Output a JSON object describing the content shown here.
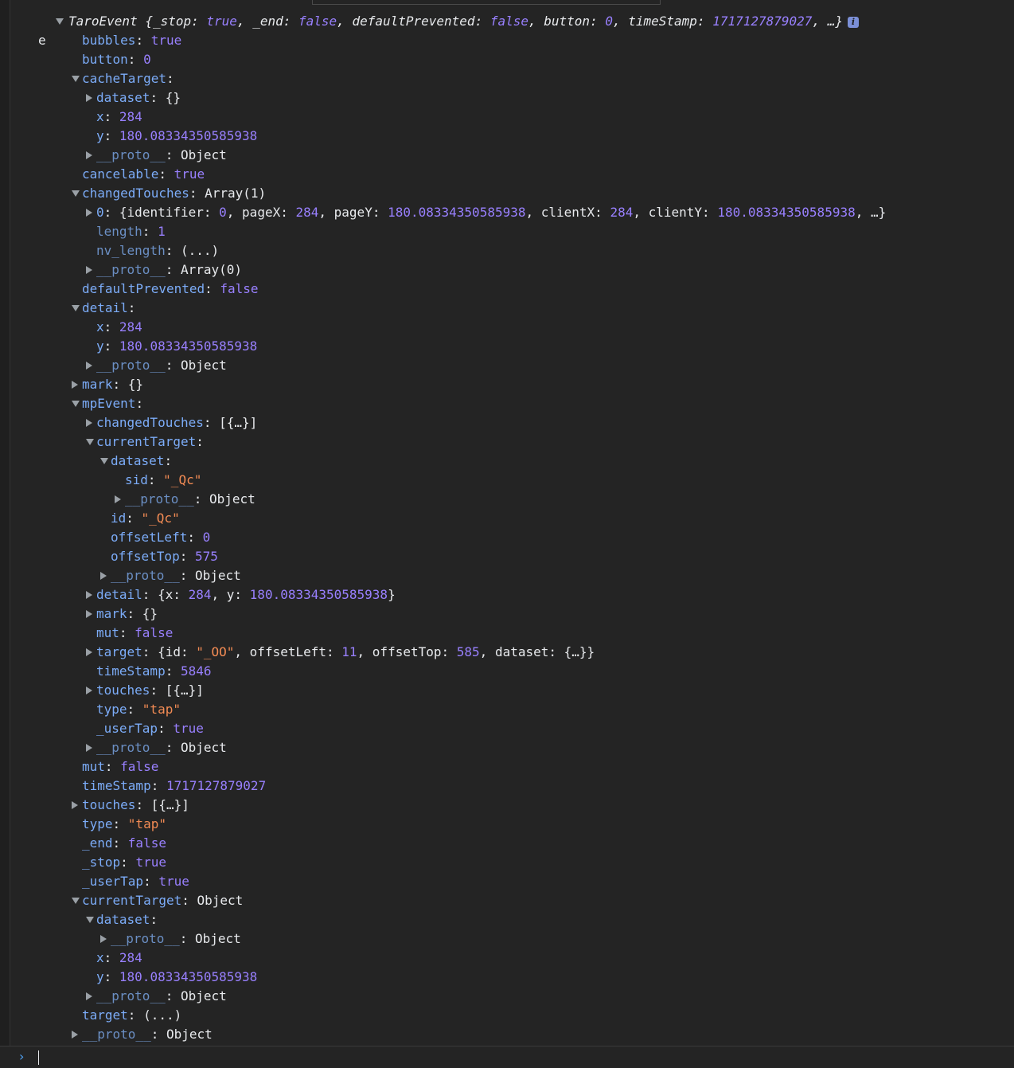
{
  "console": {
    "variable": "e",
    "summary": {
      "class_name": "TaroEvent",
      "open": "{",
      "props": [
        {
          "key": "_stop",
          "value": "true",
          "type": "b"
        },
        {
          "key": "_end",
          "value": "false",
          "type": "b"
        },
        {
          "key": "defaultPrevented",
          "value": "false",
          "type": "b"
        },
        {
          "key": "button",
          "value": "0",
          "type": "n"
        },
        {
          "key": "timeStamp",
          "value": "1717127879027",
          "type": "n"
        }
      ],
      "ellipsis": "…}",
      "info_badge": "i"
    },
    "rows": [
      {
        "indent": 1,
        "tri": "none",
        "key": "bubbles",
        "value": "true",
        "vtype": "b"
      },
      {
        "indent": 1,
        "tri": "none",
        "key": "button",
        "value": "0",
        "vtype": "n"
      },
      {
        "indent": 1,
        "tri": "open",
        "key": "cacheTarget",
        "value": "",
        "vtype": "p"
      },
      {
        "indent": 2,
        "tri": "closed",
        "key": "dataset",
        "value": "{}",
        "vtype": "p"
      },
      {
        "indent": 2,
        "tri": "none",
        "key": "x",
        "value": "284",
        "vtype": "n"
      },
      {
        "indent": 2,
        "tri": "none",
        "key": "y",
        "value": "180.08334350585938",
        "vtype": "n"
      },
      {
        "indent": 2,
        "tri": "closed",
        "key": "__proto__",
        "value": "Object",
        "vtype": "p",
        "dim": true
      },
      {
        "indent": 1,
        "tri": "none",
        "key": "cancelable",
        "value": "true",
        "vtype": "b"
      },
      {
        "indent": 1,
        "tri": "open",
        "key": "changedTouches",
        "value": "Array(1)",
        "vtype": "p"
      },
      {
        "indent": 2,
        "tri": "closed",
        "key": "0",
        "value": "",
        "vtype": "rich",
        "rich": "touch0"
      },
      {
        "indent": 2,
        "tri": "none",
        "key": "length",
        "value": "1",
        "vtype": "n",
        "dim": true
      },
      {
        "indent": 2,
        "tri": "none",
        "key": "nv_length",
        "value": "(...)",
        "vtype": "p",
        "dim": true
      },
      {
        "indent": 2,
        "tri": "closed",
        "key": "__proto__",
        "value": "Array(0)",
        "vtype": "p",
        "dim": true
      },
      {
        "indent": 1,
        "tri": "none",
        "key": "defaultPrevented",
        "value": "false",
        "vtype": "b"
      },
      {
        "indent": 1,
        "tri": "open",
        "key": "detail",
        "value": "",
        "vtype": "p"
      },
      {
        "indent": 2,
        "tri": "none",
        "key": "x",
        "value": "284",
        "vtype": "n"
      },
      {
        "indent": 2,
        "tri": "none",
        "key": "y",
        "value": "180.08334350585938",
        "vtype": "n"
      },
      {
        "indent": 2,
        "tri": "closed",
        "key": "__proto__",
        "value": "Object",
        "vtype": "p",
        "dim": true
      },
      {
        "indent": 1,
        "tri": "closed",
        "key": "mark",
        "value": "{}",
        "vtype": "p"
      },
      {
        "indent": 1,
        "tri": "open",
        "key": "mpEvent",
        "value": "",
        "vtype": "p"
      },
      {
        "indent": 2,
        "tri": "closed",
        "key": "changedTouches",
        "value": "[{…}]",
        "vtype": "p"
      },
      {
        "indent": 2,
        "tri": "open",
        "key": "currentTarget",
        "value": "",
        "vtype": "p"
      },
      {
        "indent": 3,
        "tri": "open",
        "key": "dataset",
        "value": "",
        "vtype": "p"
      },
      {
        "indent": 4,
        "tri": "none",
        "key": "sid",
        "value": "\"_Qc\"",
        "vtype": "s"
      },
      {
        "indent": 4,
        "tri": "closed",
        "key": "__proto__",
        "value": "Object",
        "vtype": "p",
        "dim": true
      },
      {
        "indent": 3,
        "tri": "none",
        "key": "id",
        "value": "\"_Qc\"",
        "vtype": "s"
      },
      {
        "indent": 3,
        "tri": "none",
        "key": "offsetLeft",
        "value": "0",
        "vtype": "n"
      },
      {
        "indent": 3,
        "tri": "none",
        "key": "offsetTop",
        "value": "575",
        "vtype": "n"
      },
      {
        "indent": 3,
        "tri": "closed",
        "key": "__proto__",
        "value": "Object",
        "vtype": "p",
        "dim": true
      },
      {
        "indent": 2,
        "tri": "closed",
        "key": "detail",
        "value": "",
        "vtype": "rich",
        "rich": "detailxy"
      },
      {
        "indent": 2,
        "tri": "closed",
        "key": "mark",
        "value": "{}",
        "vtype": "p"
      },
      {
        "indent": 2,
        "tri": "none",
        "key": "mut",
        "value": "false",
        "vtype": "b"
      },
      {
        "indent": 2,
        "tri": "closed",
        "key": "target",
        "value": "",
        "vtype": "rich",
        "rich": "target"
      },
      {
        "indent": 2,
        "tri": "none",
        "key": "timeStamp",
        "value": "5846",
        "vtype": "n"
      },
      {
        "indent": 2,
        "tri": "closed",
        "key": "touches",
        "value": "[{…}]",
        "vtype": "p"
      },
      {
        "indent": 2,
        "tri": "none",
        "key": "type",
        "value": "\"tap\"",
        "vtype": "s"
      },
      {
        "indent": 2,
        "tri": "none",
        "key": "_userTap",
        "value": "true",
        "vtype": "b"
      },
      {
        "indent": 2,
        "tri": "closed",
        "key": "__proto__",
        "value": "Object",
        "vtype": "p",
        "dim": true
      },
      {
        "indent": 1,
        "tri": "none",
        "key": "mut",
        "value": "false",
        "vtype": "b"
      },
      {
        "indent": 1,
        "tri": "none",
        "key": "timeStamp",
        "value": "1717127879027",
        "vtype": "n"
      },
      {
        "indent": 1,
        "tri": "closed",
        "key": "touches",
        "value": "[{…}]",
        "vtype": "p"
      },
      {
        "indent": 1,
        "tri": "none",
        "key": "type",
        "value": "\"tap\"",
        "vtype": "s"
      },
      {
        "indent": 1,
        "tri": "none",
        "key": "_end",
        "value": "false",
        "vtype": "b"
      },
      {
        "indent": 1,
        "tri": "none",
        "key": "_stop",
        "value": "true",
        "vtype": "b"
      },
      {
        "indent": 1,
        "tri": "none",
        "key": "_userTap",
        "value": "true",
        "vtype": "b"
      },
      {
        "indent": 1,
        "tri": "open",
        "key": "currentTarget",
        "value": "Object",
        "vtype": "p"
      },
      {
        "indent": 2,
        "tri": "open",
        "key": "dataset",
        "value": "",
        "vtype": "p"
      },
      {
        "indent": 3,
        "tri": "closed",
        "key": "__proto__",
        "value": "Object",
        "vtype": "p",
        "dim": true
      },
      {
        "indent": 2,
        "tri": "none",
        "key": "x",
        "value": "284",
        "vtype": "n"
      },
      {
        "indent": 2,
        "tri": "none",
        "key": "y",
        "value": "180.08334350585938",
        "vtype": "n"
      },
      {
        "indent": 2,
        "tri": "closed",
        "key": "__proto__",
        "value": "Object",
        "vtype": "p",
        "dim": true
      },
      {
        "indent": 1,
        "tri": "none",
        "key": "target",
        "value": "(...)",
        "vtype": "p"
      },
      {
        "indent": 1,
        "tri": "closed",
        "key": "__proto__",
        "value": "Object",
        "vtype": "p",
        "dim": true
      }
    ],
    "rich": {
      "touch0": [
        {
          "t": "p",
          "v": "{"
        },
        {
          "t": "p",
          "v": "identifier: "
        },
        {
          "t": "n",
          "v": "0"
        },
        {
          "t": "p",
          "v": ", "
        },
        {
          "t": "p",
          "v": "pageX: "
        },
        {
          "t": "n",
          "v": "284"
        },
        {
          "t": "p",
          "v": ", "
        },
        {
          "t": "p",
          "v": "pageY: "
        },
        {
          "t": "n",
          "v": "180.08334350585938"
        },
        {
          "t": "p",
          "v": ", "
        },
        {
          "t": "p",
          "v": "clientX: "
        },
        {
          "t": "n",
          "v": "284"
        },
        {
          "t": "p",
          "v": ", "
        },
        {
          "t": "p",
          "v": "clientY: "
        },
        {
          "t": "n",
          "v": "180.08334350585938"
        },
        {
          "t": "p",
          "v": ", …}"
        }
      ],
      "detailxy": [
        {
          "t": "p",
          "v": "{x: "
        },
        {
          "t": "n",
          "v": "284"
        },
        {
          "t": "p",
          "v": ", y: "
        },
        {
          "t": "n",
          "v": "180.08334350585938"
        },
        {
          "t": "p",
          "v": "}"
        }
      ],
      "target": [
        {
          "t": "p",
          "v": "{id: "
        },
        {
          "t": "s",
          "v": "\"_OO\""
        },
        {
          "t": "p",
          "v": ", offsetLeft: "
        },
        {
          "t": "n",
          "v": "11"
        },
        {
          "t": "p",
          "v": ", offsetTop: "
        },
        {
          "t": "n",
          "v": "585"
        },
        {
          "t": "p",
          "v": ", dataset: {…}}"
        }
      ]
    },
    "prompt_symbol": "›"
  },
  "colors": {
    "background": "#242424",
    "key": "#7cacf8",
    "number_bool": "#9980ff",
    "string": "#f28b54",
    "text": "#e8eaed",
    "prompt": "#4ea1f3"
  }
}
